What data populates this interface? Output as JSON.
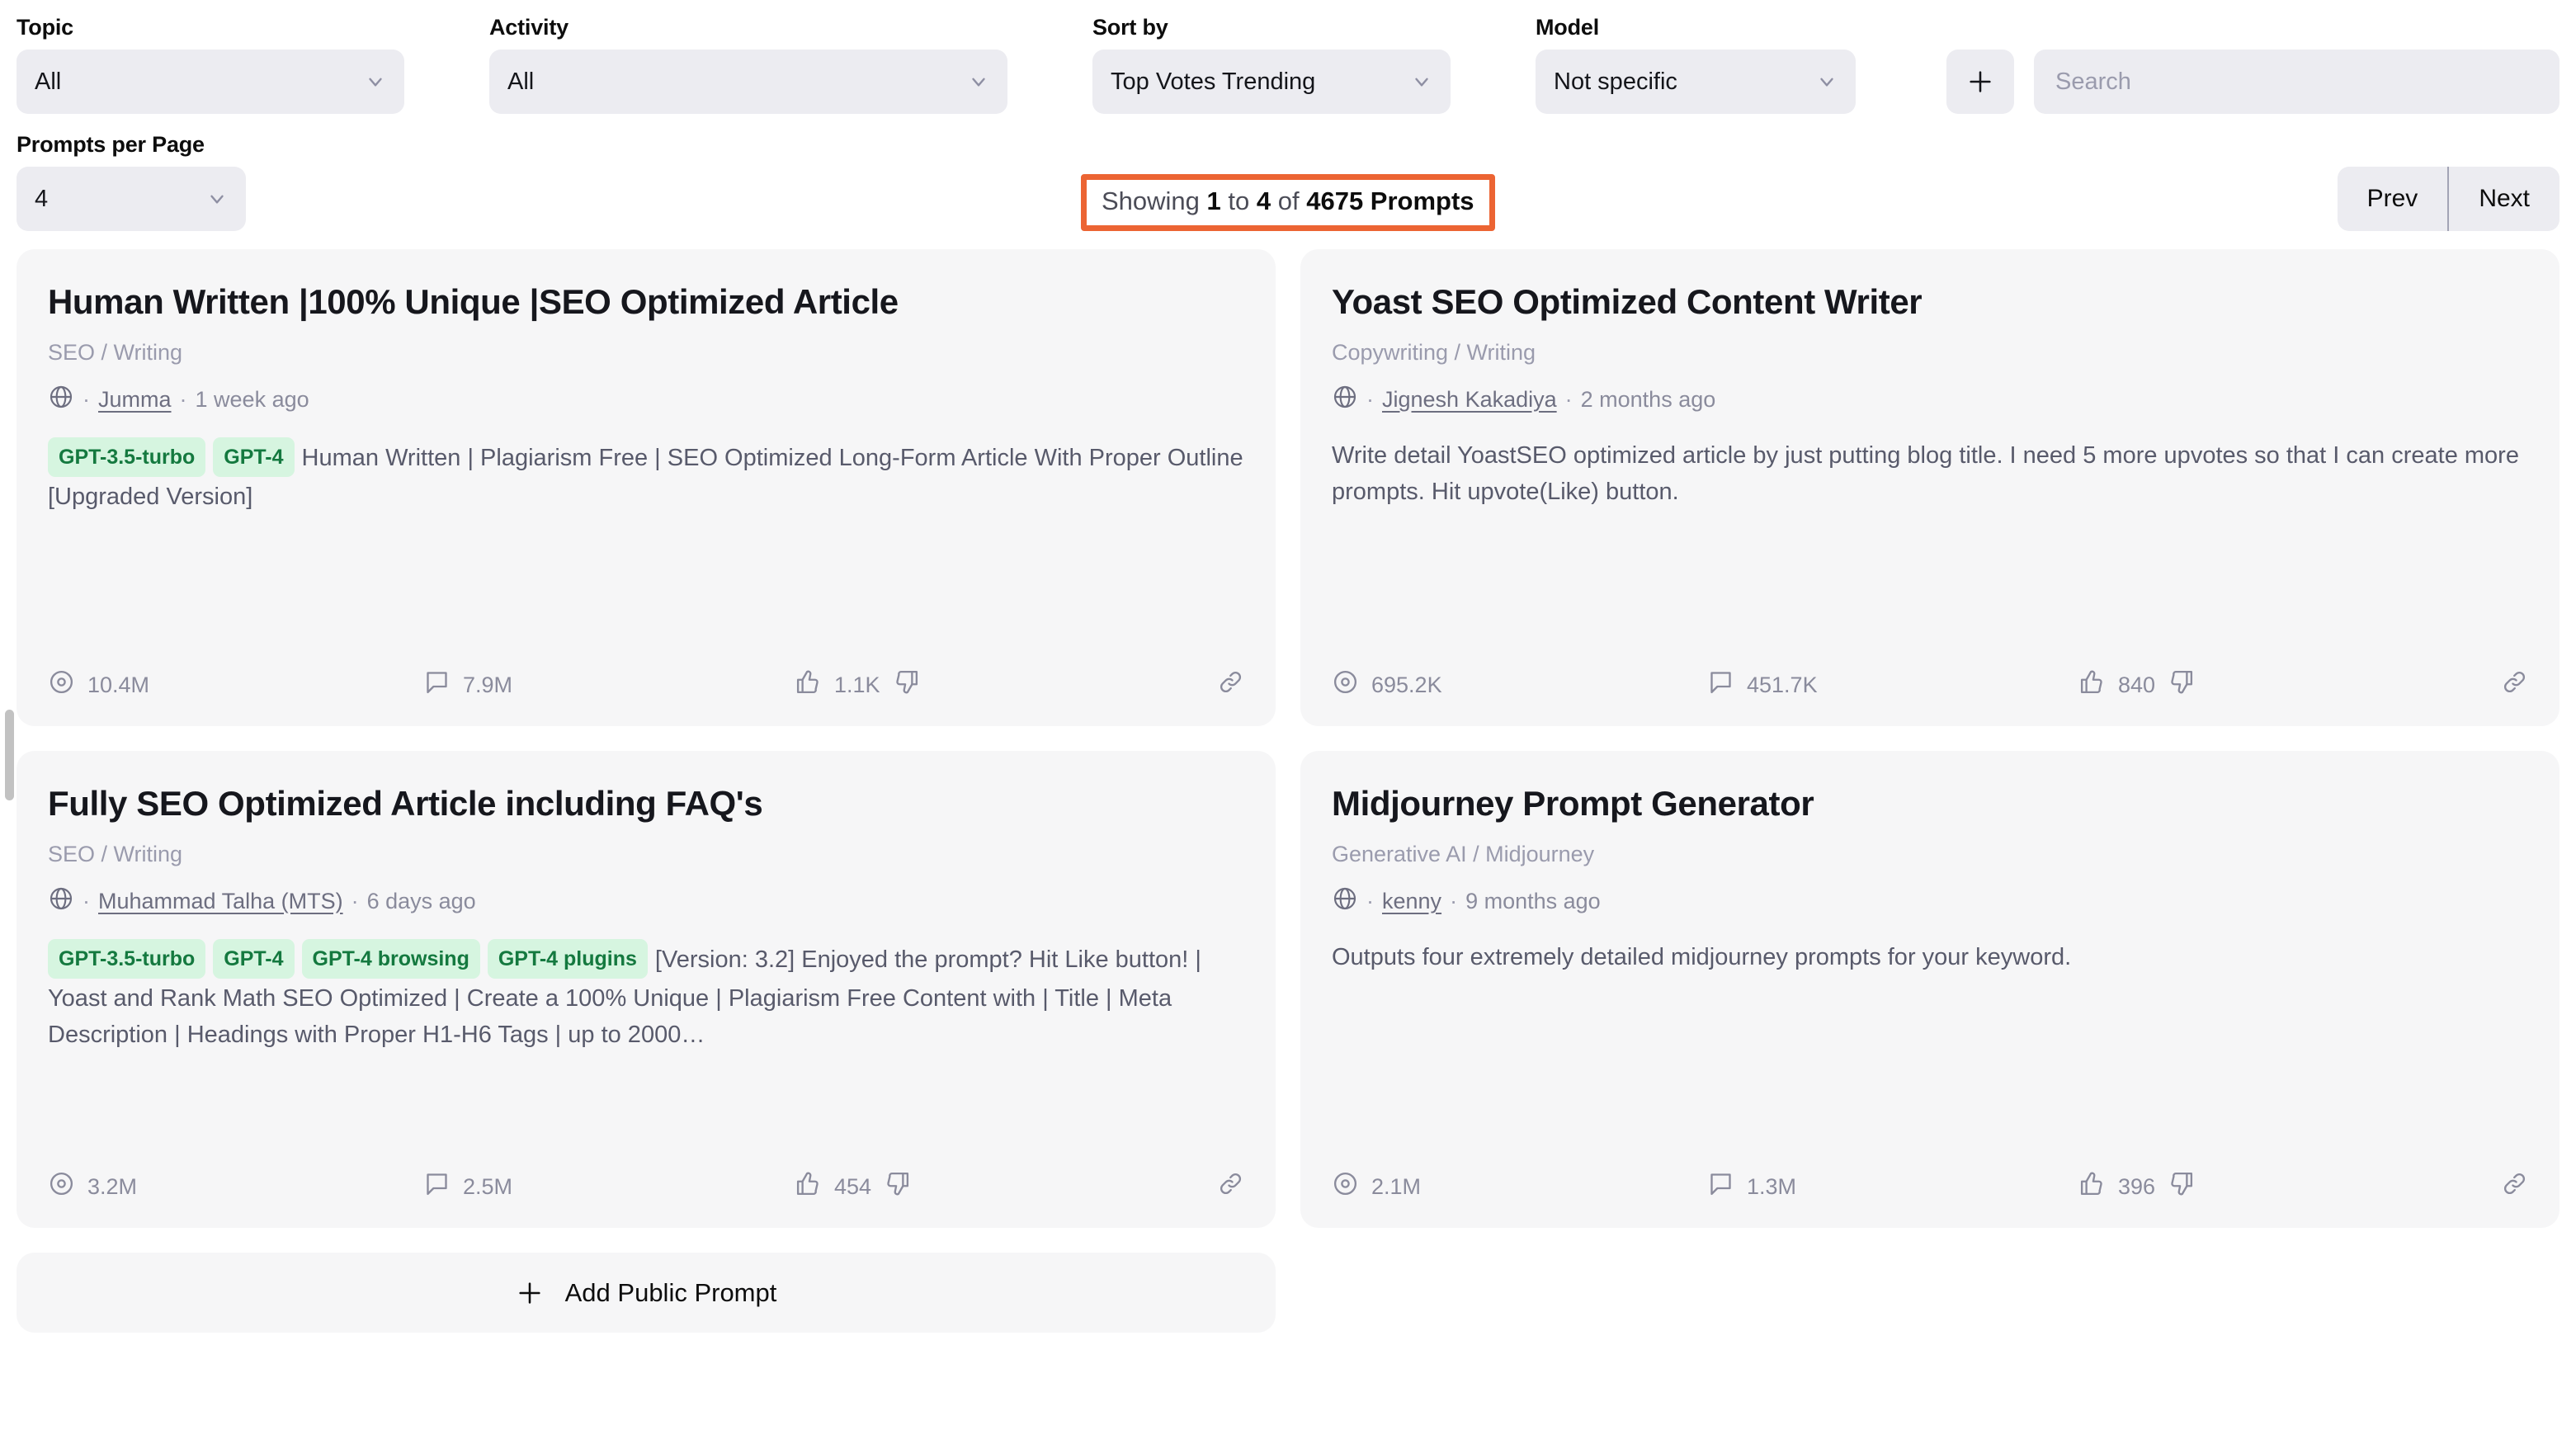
{
  "filters": {
    "topic": {
      "label": "Topic",
      "value": "All"
    },
    "activity": {
      "label": "Activity",
      "value": "All"
    },
    "sort_by": {
      "label": "Sort by",
      "value": "Top Votes Trending"
    },
    "model": {
      "label": "Model",
      "value": "Not specific"
    },
    "add_icon": "plus-icon",
    "search": {
      "placeholder": "Search",
      "value": ""
    }
  },
  "pagination": {
    "per_page_label": "Prompts per Page",
    "per_page_value": "4",
    "showing_prefix": "Showing ",
    "showing_from": "1",
    "showing_mid": " to ",
    "showing_to": "4",
    "showing_of": " of ",
    "showing_total": "4675 Prompts",
    "prev_label": "Prev",
    "next_label": "Next",
    "highlight_color": "#ec6433"
  },
  "cards": [
    {
      "title": "Human Written |100% Unique |SEO Optimized Article",
      "category": "SEO / Writing",
      "globe_icon": "globe-icon",
      "author": "Jumma",
      "ago": "1 week ago",
      "tags": [
        "GPT-3.5-turbo",
        "GPT-4"
      ],
      "description": "Human Written | Plagiarism Free | SEO Optimized Long-Form Article With Proper Outline [Upgraded Version]",
      "stats": {
        "views_icon": "eye-icon",
        "views": "10.4M",
        "comments_icon": "comment-icon",
        "comments": "7.9M",
        "upvote_icon": "thumbs-up-icon",
        "upvotes": "1.1K",
        "downvote_icon": "thumbs-down-icon",
        "link_icon": "link-icon"
      }
    },
    {
      "title": "Yoast SEO Optimized Content Writer",
      "category": "Copywriting / Writing",
      "globe_icon": "globe-icon",
      "author": "Jignesh Kakadiya",
      "ago": "2 months ago",
      "tags": [],
      "description": "Write detail YoastSEO optimized article by just putting blog title. I need 5 more upvotes so that I can create more prompts. Hit upvote(Like) button.",
      "stats": {
        "views_icon": "eye-icon",
        "views": "695.2K",
        "comments_icon": "comment-icon",
        "comments": "451.7K",
        "upvote_icon": "thumbs-up-icon",
        "upvotes": "840",
        "downvote_icon": "thumbs-down-icon",
        "link_icon": "link-icon"
      }
    },
    {
      "title": "Fully SEO Optimized Article including FAQ's",
      "category": "SEO / Writing",
      "globe_icon": "globe-icon",
      "author": "Muhammad Talha (MTS)",
      "ago": "6 days ago",
      "tags": [
        "GPT-3.5-turbo",
        "GPT-4",
        "GPT-4 browsing",
        "GPT-4 plugins"
      ],
      "description": "[Version: 3.2] Enjoyed the prompt? Hit Like button! | Yoast and Rank Math SEO Optimized | Create a 100% Unique | Plagiarism Free Content with | Title | Meta Description | Headings with Proper H1-H6 Tags | up to 2000…",
      "stats": {
        "views_icon": "eye-icon",
        "views": "3.2M",
        "comments_icon": "comment-icon",
        "comments": "2.5M",
        "upvote_icon": "thumbs-up-icon",
        "upvotes": "454",
        "downvote_icon": "thumbs-down-icon",
        "link_icon": "link-icon"
      }
    },
    {
      "title": "Midjourney Prompt Generator",
      "category": "Generative AI / Midjourney",
      "globe_icon": "globe-icon",
      "author": "kenny",
      "ago": "9 months ago",
      "tags": [],
      "description": "Outputs four extremely detailed midjourney prompts for your keyword.",
      "stats": {
        "views_icon": "eye-icon",
        "views": "2.1M",
        "comments_icon": "comment-icon",
        "comments": "1.3M",
        "upvote_icon": "thumbs-up-icon",
        "upvotes": "396",
        "downvote_icon": "thumbs-down-icon",
        "link_icon": "link-icon"
      }
    }
  ],
  "add_prompt": {
    "icon": "plus-icon",
    "label": "Add Public Prompt"
  }
}
